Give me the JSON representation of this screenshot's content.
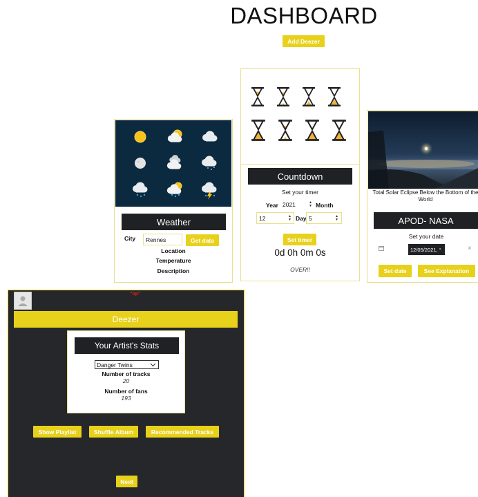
{
  "header": {
    "title": "DASHBOARD",
    "add_button": "Add Deezer"
  },
  "weather": {
    "title": "Weather",
    "city_label": "City",
    "city_value": "Rennes",
    "get_button": "Get data",
    "location_label": "Location",
    "temperature_label": "Temperature",
    "description_label": "Description",
    "icons": [
      "sun-icon",
      "partly-cloudy-icon",
      "cloud-icon",
      "moon-icon",
      "cloudy-icon",
      "night-snow-icon",
      "rain-icon",
      "sun-rain-icon",
      "thunderstorm-icon"
    ]
  },
  "countdown": {
    "title": "Countdown",
    "subtitle": "Set your timer",
    "year_label": "Year",
    "year_value": "2021",
    "month_label": "Month",
    "month_value": "12",
    "day_label": "Day",
    "day_value": "5",
    "set_button": "Set timer",
    "remaining": "0d 0h 0m 0s",
    "status": "OVER!!"
  },
  "apod": {
    "caption": "Total Solar Eclipse Below the Bottom of the World",
    "title": "APOD- NASA",
    "subtitle": "Set your date",
    "date_value": "12/05/2021, °",
    "clear_glyph": "×",
    "set_button": "Set date",
    "explain_button": "See Explanation"
  },
  "deezer": {
    "top_badge": "“op”",
    "header": "Deezer",
    "stats_title": "Your Artist's Stats",
    "artist_selected": "Danger Twins",
    "tracks_label": "Number of tracks",
    "tracks_value": "20",
    "fans_label": "Number of fans",
    "fans_value": "193",
    "buttons": {
      "playlist": "Show Playlist",
      "shuffle": "Shuffle Album",
      "recommended": "Recommended Tracks"
    },
    "next_button": "Next"
  },
  "colors": {
    "accent": "#e8d11a",
    "dark": "#202124",
    "card_border": "#e9df8e",
    "weather_bg": "#0b2a40"
  }
}
